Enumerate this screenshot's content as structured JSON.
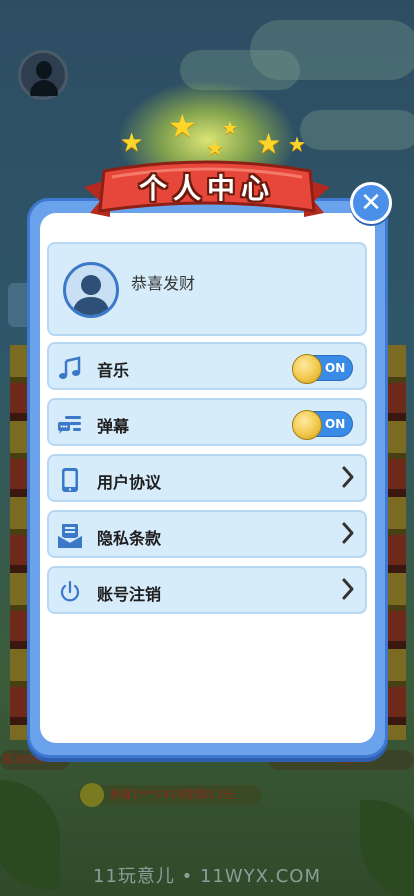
{
  "modal": {
    "title": "个人中心",
    "close_symbol": "✕"
  },
  "profile": {
    "username": "恭喜发财"
  },
  "settings": [
    {
      "label": "音乐",
      "icon": "music-note-icon",
      "control": "toggle",
      "state": "ON"
    },
    {
      "label": "弹幕",
      "icon": "bullet-comment-icon",
      "control": "toggle",
      "state": "ON"
    },
    {
      "label": "用户协议",
      "icon": "phone-icon",
      "control": "chevron"
    },
    {
      "label": "隐私条款",
      "icon": "document-icon",
      "control": "chevron"
    },
    {
      "label": "账号注销",
      "icon": "power-icon",
      "control": "chevron"
    }
  ],
  "background": {
    "notice": "恭喜1***7419提现0.3元",
    "left_notice": "现300元",
    "right_notice": "现300"
  },
  "watermark": "11玩意儿 • 11WYX.COM",
  "colors": {
    "panel": "#6aa3ec",
    "card": "#d6ecfb",
    "toggle": "#3a8be6",
    "ribbon": "#e6473a",
    "icon": "#3c78c8"
  }
}
